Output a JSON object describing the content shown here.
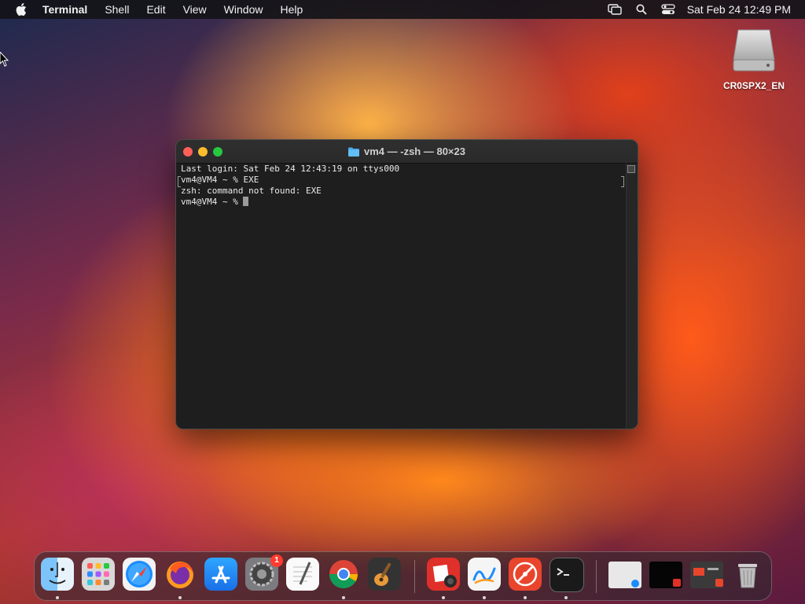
{
  "menubar": {
    "apple_icon": "apple-icon",
    "app_name": "Terminal",
    "menus": [
      "Shell",
      "Edit",
      "View",
      "Window",
      "Help"
    ],
    "status_icons": [
      "screen-mirroring-icon",
      "spotlight-search-icon",
      "control-center-icon"
    ],
    "clock": "Sat Feb 24  12:49 PM"
  },
  "desktop": {
    "disk_label": "CR0SPX2_EN"
  },
  "terminal": {
    "title": "vm4 — -zsh — 80×23",
    "lines": [
      "Last login: Sat Feb 24 12:43:19 on ttys000",
      "vm4@VM4 ~ % EXE",
      "zsh: command not found: EXE",
      "vm4@VM4 ~ % "
    ]
  },
  "dock": {
    "items": [
      {
        "name": "Finder",
        "icon": "finder-icon",
        "running": true
      },
      {
        "name": "Launchpad",
        "icon": "launchpad-icon",
        "running": false
      },
      {
        "name": "Safari",
        "icon": "safari-icon",
        "running": false
      },
      {
        "name": "Firefox",
        "icon": "firefox-icon",
        "running": true
      },
      {
        "name": "App Store",
        "icon": "app-store-icon",
        "running": false
      },
      {
        "name": "System Settings",
        "icon": "system-settings-icon",
        "running": false,
        "badge": "1"
      },
      {
        "name": "TextEdit",
        "icon": "textedit-icon",
        "running": false
      },
      {
        "name": "Chrome",
        "icon": "chrome-icon",
        "running": true
      },
      {
        "name": "GarageBand",
        "icon": "garageband-icon",
        "running": false
      },
      {
        "name": "Photo Booth",
        "icon": "photo-booth-icon",
        "running": true
      },
      {
        "name": "Freeform",
        "icon": "freeform-icon",
        "running": true
      },
      {
        "name": "Compass",
        "icon": "compass-icon",
        "running": true
      },
      {
        "name": "Terminal",
        "icon": "terminal-icon",
        "running": true
      },
      {
        "name": "Window 1",
        "icon": "minimized-window-icon",
        "running": false
      },
      {
        "name": "Window 2",
        "icon": "minimized-window-icon",
        "running": false
      },
      {
        "name": "Window 3",
        "icon": "minimized-window-icon",
        "running": false
      },
      {
        "name": "Trash",
        "icon": "trash-icon",
        "running": false
      }
    ]
  },
  "colors": {
    "terminal_bg": "#1e1e1e",
    "close": "#ff5f57",
    "minimize": "#febc2e",
    "maximize": "#28c840",
    "badge": "#ff3b30"
  }
}
